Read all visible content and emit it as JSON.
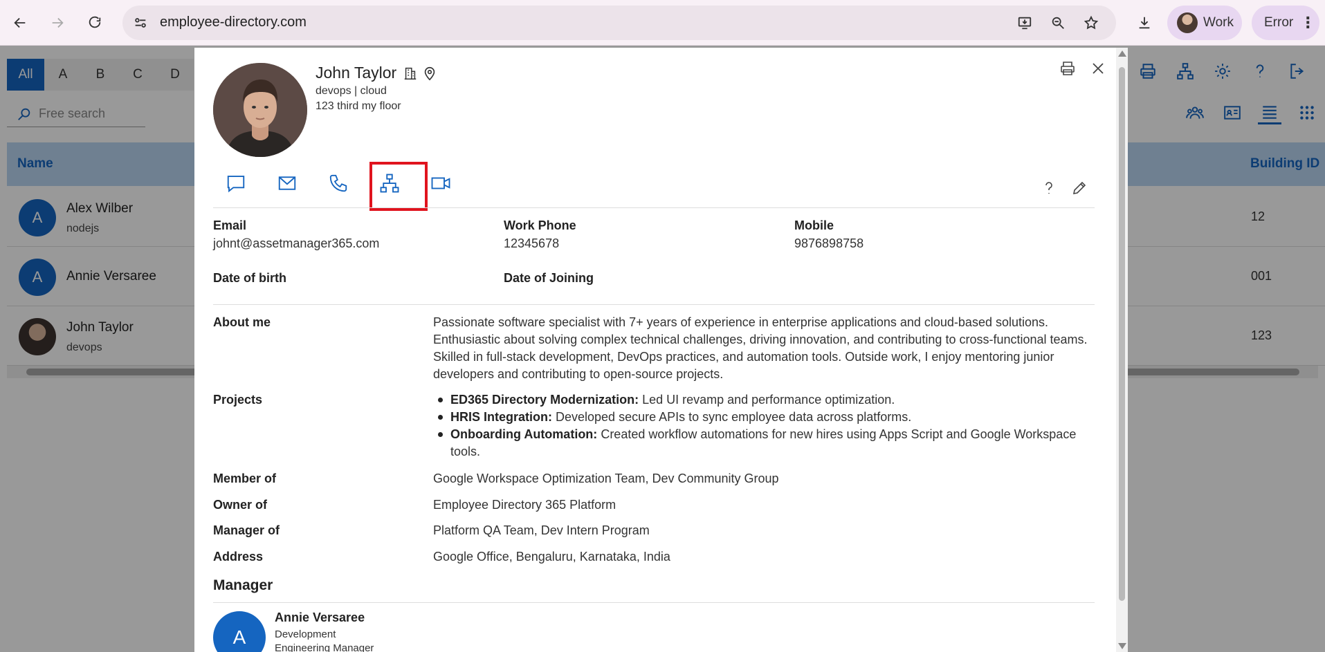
{
  "browser": {
    "url": "employee-directory.com",
    "profile_label": "Work",
    "error_label": "Error"
  },
  "app": {
    "alphabet": [
      "All",
      "A",
      "B",
      "C",
      "D"
    ],
    "search_placeholder": "Free search",
    "columns": {
      "name": "Name",
      "building_id": "Building ID"
    },
    "rows": [
      {
        "initial": "A",
        "name": "Alex Wilber",
        "sub": "nodejs",
        "building_id": "12"
      },
      {
        "initial": "A",
        "name": "Annie Versaree",
        "sub": "",
        "building_id": "001"
      },
      {
        "initial": "",
        "name": "John Taylor",
        "sub": "devops",
        "building_id": "123"
      }
    ]
  },
  "profile": {
    "name": "John Taylor",
    "department": "devops | cloud",
    "location": "123 third my floor",
    "actions": [
      "chat-icon",
      "mail-icon",
      "phone-icon",
      "org-chart-icon",
      "video-icon"
    ],
    "contact": {
      "email_label": "Email",
      "email": "johnt@assetmanager365.com",
      "work_phone_label": "Work Phone",
      "work_phone": "12345678",
      "mobile_label": "Mobile",
      "mobile": "9876898758",
      "dob_label": "Date of birth",
      "doj_label": "Date of Joining"
    },
    "about_label": "About me",
    "about": "Passionate software specialist with 7+ years of experience in enterprise applications and cloud-based solutions. Enthusiastic about solving complex technical challenges, driving innovation, and contributing to cross-functional teams. Skilled in full-stack development, DevOps practices, and automation tools. Outside work, I enjoy mentoring junior developers and contributing to open-source projects.",
    "projects_label": "Projects",
    "projects": [
      {
        "title": "ED365 Directory Modernization:",
        "desc": " Led UI revamp and performance optimization."
      },
      {
        "title": "HRIS Integration:",
        "desc": " Developed secure APIs to sync employee data across platforms."
      },
      {
        "title": "Onboarding Automation:",
        "desc": " Created workflow automations for new hires using Apps Script and Google Workspace tools."
      }
    ],
    "member_of_label": "Member of",
    "member_of": "Google Workspace Optimization Team, Dev Community Group",
    "owner_of_label": "Owner of",
    "owner_of": "Employee Directory 365 Platform",
    "manager_of_label": "Manager of",
    "manager_of": "Platform QA Team, Dev Intern Program",
    "address_label": "Address",
    "address": "Google Office, Bengaluru, Karnataka, India",
    "manager_section": "Manager",
    "manager": {
      "initial": "A",
      "name": "Annie Versaree",
      "department": "Development",
      "title": "Engineering Manager"
    }
  },
  "colors": {
    "accent": "#1565c0",
    "highlight": "#e0141e"
  }
}
